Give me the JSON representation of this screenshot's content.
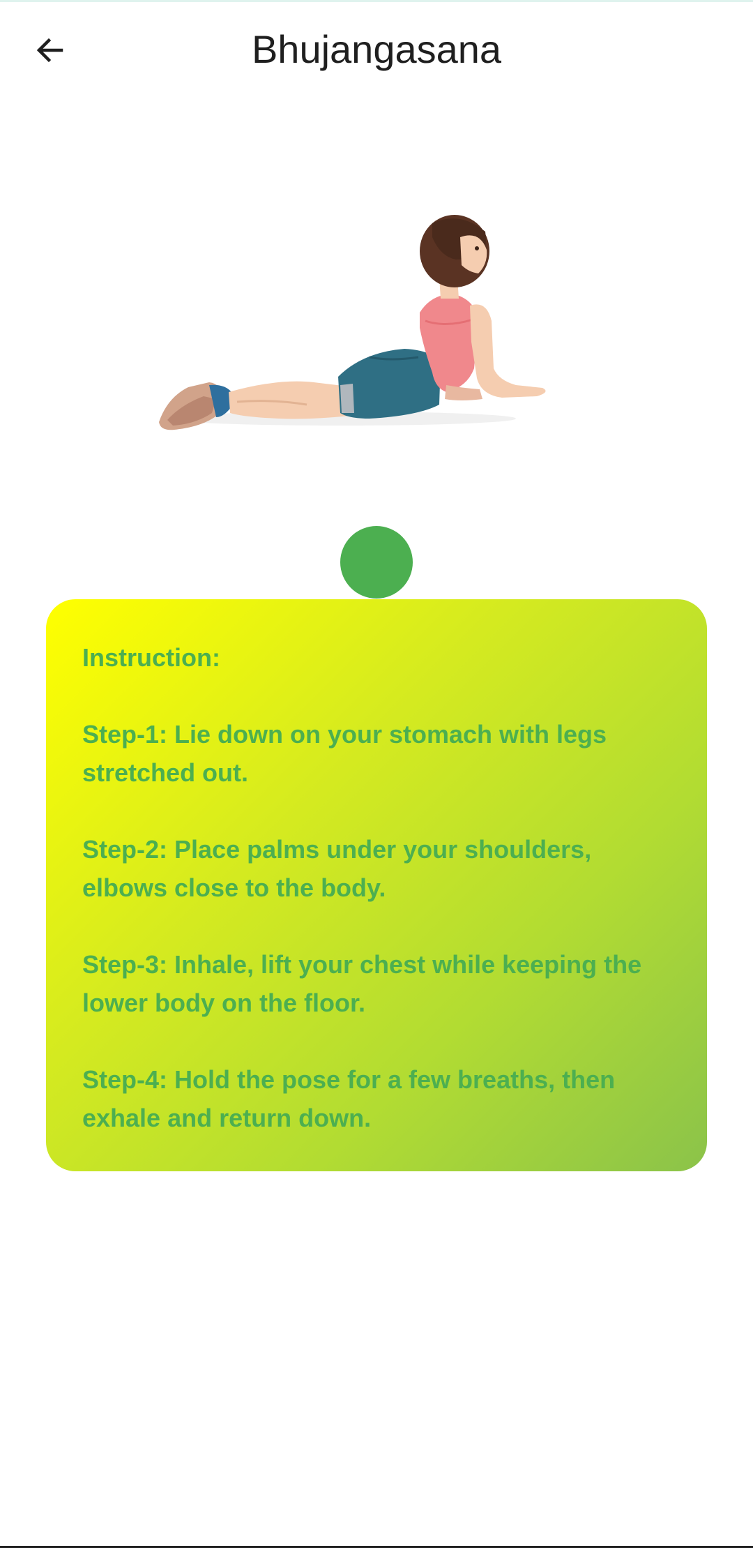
{
  "app_bar": {
    "title": "Bhujangasana",
    "back_icon": "arrow-left-icon"
  },
  "pose_image": {
    "subject": "cobra-pose-illustration"
  },
  "indicator": {
    "color": "#4caf50"
  },
  "instructions": {
    "heading": "Instruction:",
    "steps": [
      "Step-1: Lie down on your stomach with legs stretched out.",
      "Step-2: Place palms under your shoulders, elbows close to the body.",
      "Step-3: Inhale, lift your chest while keeping the lower body on the floor.",
      "Step-4: Hold the pose for a few breaths, then exhale and return down."
    ],
    "text_color": "#4caf50",
    "gradient_start": "#ffff00",
    "gradient_end": "#8bc34a"
  }
}
